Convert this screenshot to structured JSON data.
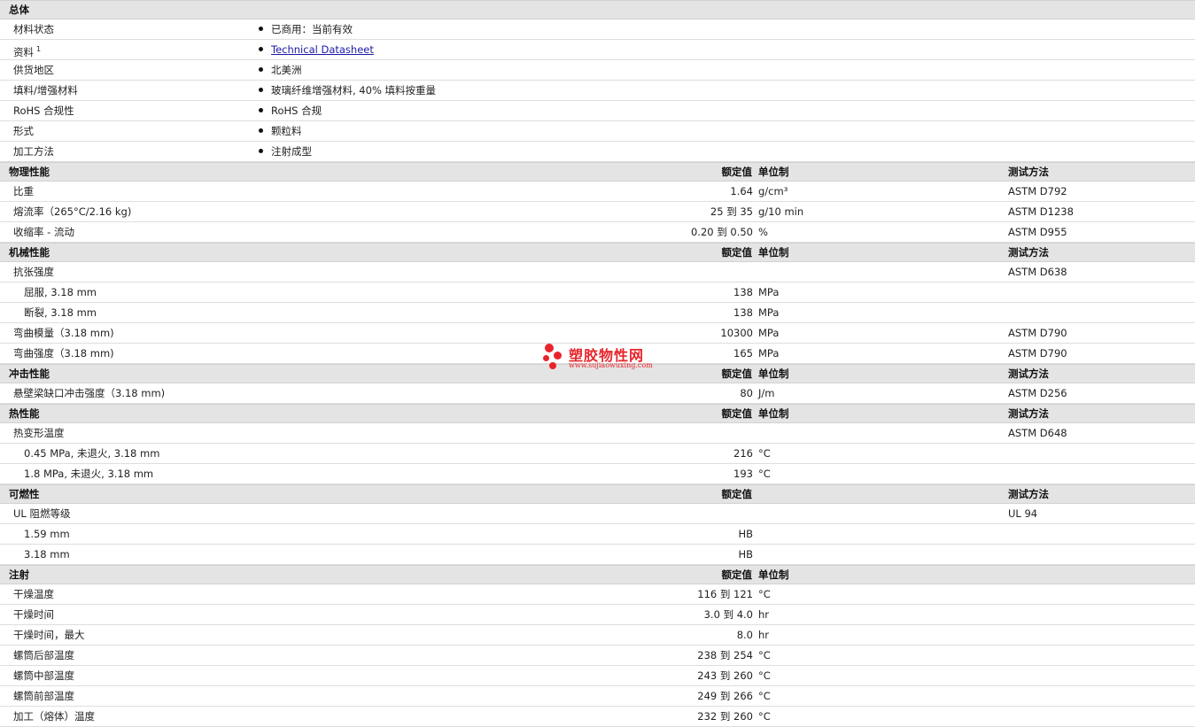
{
  "general": {
    "title": "总体",
    "rows": [
      {
        "label": "材料状态",
        "value": "已商用：当前有效"
      },
      {
        "label": "资料",
        "sup": "1",
        "value": "Technical Datasheet",
        "link": true
      },
      {
        "label": "供货地区",
        "value": "北美洲"
      },
      {
        "label": "填料/增强材料",
        "value": "玻璃纤维增强材料, 40% 填料按重量"
      },
      {
        "label": "RoHS 合规性",
        "value": "RoHS 合规"
      },
      {
        "label": "形式",
        "value": "颗粒料"
      },
      {
        "label": "加工方法",
        "value": "注射成型"
      }
    ]
  },
  "col_headers": {
    "value": "额定值",
    "unit": "单位制",
    "test": "测试方法"
  },
  "sections": [
    {
      "title": "物理性能",
      "show_unit": true,
      "rows": [
        {
          "label": "比重",
          "value": "1.64",
          "unit": "g/cm³",
          "test": "ASTM D792"
        },
        {
          "label": "熔流率（265°C/2.16 kg)",
          "value": "25 到  35",
          "unit": "g/10 min",
          "test": "ASTM D1238"
        },
        {
          "label": "收缩率 - 流动",
          "value": "0.20 到  0.50",
          "unit": "%",
          "test": "ASTM D955"
        }
      ]
    },
    {
      "title": "机械性能",
      "show_unit": true,
      "rows": [
        {
          "label": "抗张强度",
          "value": "",
          "unit": "",
          "test": "ASTM D638"
        },
        {
          "label": "屈服, 3.18 mm",
          "sub": true,
          "value": "138",
          "unit": "MPa",
          "test": ""
        },
        {
          "label": "断裂, 3.18 mm",
          "sub": true,
          "value": "138",
          "unit": "MPa",
          "test": ""
        },
        {
          "label": "弯曲模量（3.18 mm)",
          "value": "10300",
          "unit": "MPa",
          "test": "ASTM D790"
        },
        {
          "label": "弯曲强度（3.18 mm)",
          "value": "165",
          "unit": "MPa",
          "test": "ASTM D790"
        }
      ]
    },
    {
      "title": "冲击性能",
      "show_unit": true,
      "rows": [
        {
          "label": "悬壁梁缺口冲击强度（3.18 mm)",
          "value": "80",
          "unit": "J/m",
          "test": "ASTM D256"
        }
      ]
    },
    {
      "title": "热性能",
      "show_unit": true,
      "rows": [
        {
          "label": "热变形温度",
          "value": "",
          "unit": "",
          "test": "ASTM D648"
        },
        {
          "label": "0.45 MPa, 未退火, 3.18 mm",
          "sub": true,
          "value": "216",
          "unit": "°C",
          "test": ""
        },
        {
          "label": "1.8 MPa, 未退火, 3.18 mm",
          "sub": true,
          "value": "193",
          "unit": "°C",
          "test": ""
        }
      ]
    },
    {
      "title": "可燃性",
      "show_unit": false,
      "rows": [
        {
          "label": "UL 阻燃等级",
          "value": "",
          "unit": "",
          "test": "UL 94"
        },
        {
          "label": "1.59 mm",
          "sub": true,
          "value": "HB",
          "unit": "",
          "test": ""
        },
        {
          "label": "3.18 mm",
          "sub": true,
          "value": "HB",
          "unit": "",
          "test": ""
        }
      ]
    },
    {
      "title": "注射",
      "show_unit": true,
      "no_test": true,
      "rows": [
        {
          "label": "干燥温度",
          "value": "116 到  121",
          "unit": "°C",
          "test": ""
        },
        {
          "label": "干燥时间",
          "value": "3.0 到  4.0",
          "unit": "hr",
          "test": ""
        },
        {
          "label": "干燥时间，最大",
          "value": "8.0",
          "unit": "hr",
          "test": ""
        },
        {
          "label": "螺筒后部温度",
          "value": "238 到  254",
          "unit": "°C",
          "test": ""
        },
        {
          "label": "螺筒中部温度",
          "value": "243 到  260",
          "unit": "°C",
          "test": ""
        },
        {
          "label": "螺筒前部温度",
          "value": "249 到  266",
          "unit": "°C",
          "test": ""
        },
        {
          "label": "加工（熔体）温度",
          "value": "232 到  260",
          "unit": "°C",
          "test": ""
        }
      ]
    }
  ],
  "watermark": {
    "cn": "塑胶物性网",
    "en": "www.sujiaowuxing.com",
    "color": "#e8242a"
  }
}
